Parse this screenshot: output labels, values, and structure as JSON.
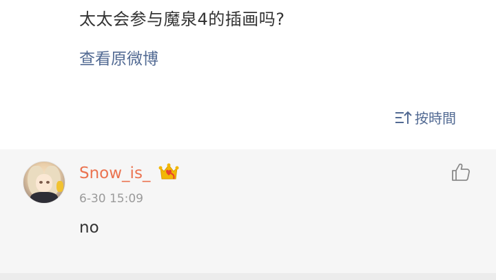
{
  "post": {
    "text": "太太会参与魔泉4的插画吗?",
    "view_original_label": "查看原微博"
  },
  "sort": {
    "label": "按時間",
    "icon": "sort-icon"
  },
  "comment": {
    "username": "Snow_is_",
    "timestamp": "6-30 15:09",
    "text": "no",
    "avatar_icon": "user-avatar",
    "badge_icon": "vip-crown-icon",
    "like_icon": "thumbs-up-icon"
  },
  "colors": {
    "link": "#526a93",
    "username": "#eb7350",
    "comment_bg": "#f6f6f6",
    "badge_gold": "#f2b705",
    "badge_red": "#e8412e"
  }
}
